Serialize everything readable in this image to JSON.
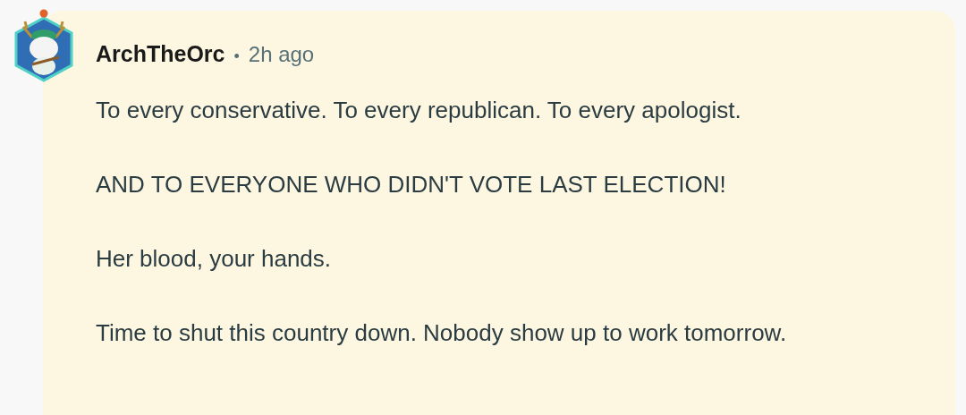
{
  "comment": {
    "author": "ArchTheOrc",
    "separator": "•",
    "time": "2h ago",
    "paragraphs": [
      "To every conservative. To every republican. To every apologist.",
      "AND TO EVERYONE WHO DIDN'T VOTE LAST ELECTION!",
      "Her blood, your hands.",
      "Time to shut this country down. Nobody show up to work tomorrow."
    ]
  }
}
